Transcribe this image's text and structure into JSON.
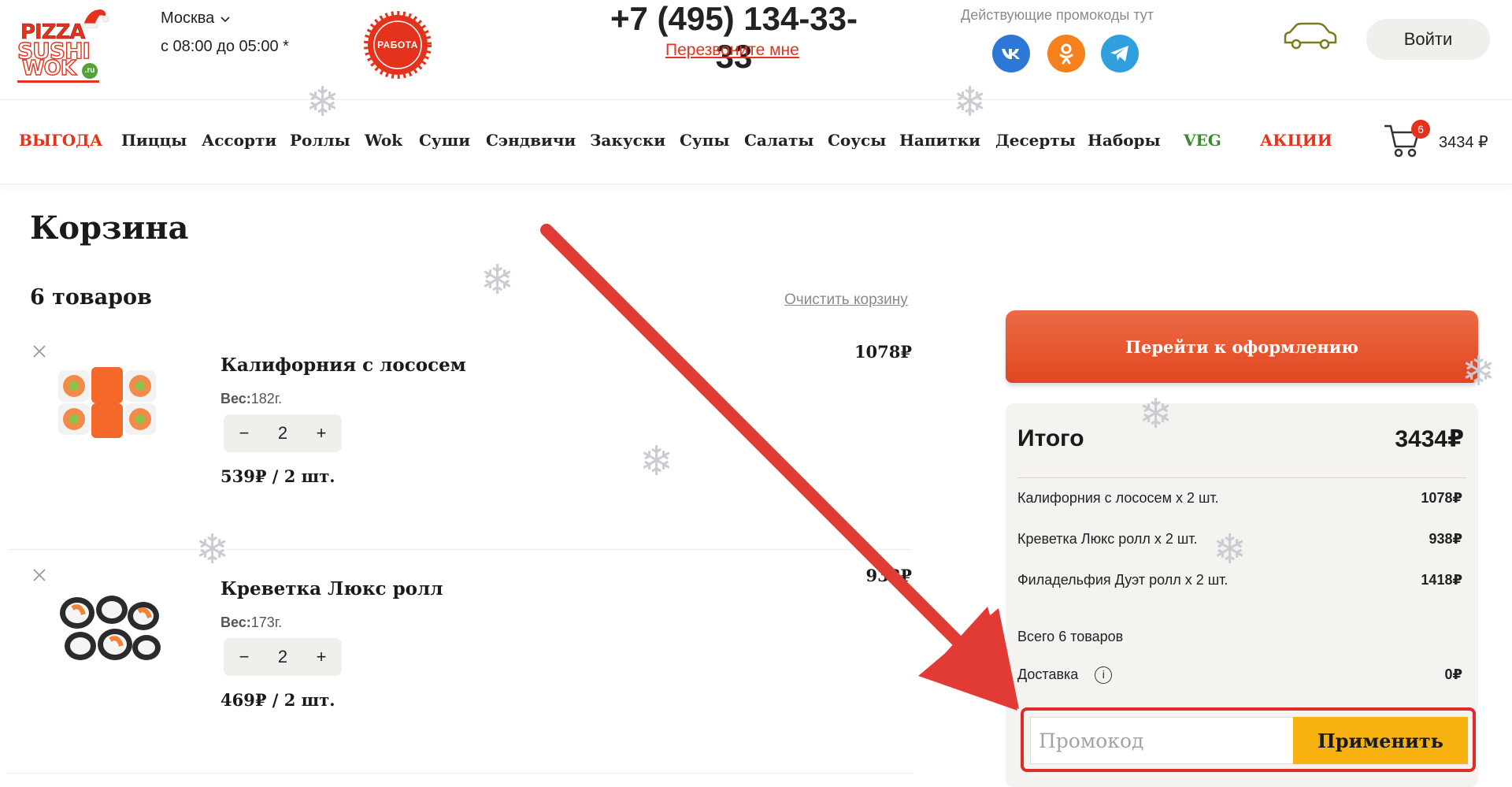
{
  "header": {
    "logo": {
      "line1": "PIZZA",
      "line2": "SUSHI",
      "line3": "WOK",
      "ru": ".ru"
    },
    "city": "Москва",
    "hours": "с 08:00 до 05:00 *",
    "work_badge": "РАБОТА",
    "phone": "+7 (495) 134-33-33",
    "callback": "Перезвоните мне",
    "promo_label": "Действующие промокоды тут",
    "social": {
      "vk": "vk",
      "ok": "ok",
      "tg": "tg"
    },
    "login": "Войти"
  },
  "nav": {
    "items": [
      "ВЫГОДА",
      "Пиццы",
      "Ассорти",
      "Роллы",
      "Wok",
      "Суши",
      "Сэндвичи",
      "Закуски",
      "Супы",
      "Салаты",
      "Соусы",
      "Напитки",
      "Десерты",
      "Наборы",
      "VEG",
      "АКЦИИ"
    ],
    "cart_count": "6",
    "cart_total": "3434 ₽"
  },
  "cart": {
    "title": "Корзина",
    "items_count": "6 товаров",
    "clear": "Очистить корзину",
    "items": [
      {
        "name": "Калифорния с лососем",
        "weight_label": "Вес:",
        "weight": "182г.",
        "qty": "2",
        "unit": "539₽ / 2 шт.",
        "price": "1078₽"
      },
      {
        "name": "Креветка Люкс ролл",
        "weight_label": "Вес:",
        "weight": "173г.",
        "qty": "2",
        "unit": "469₽ / 2 шт.",
        "price": "938₽"
      }
    ],
    "minus": "−",
    "plus": "+"
  },
  "summary": {
    "checkout": "Перейти к оформлению",
    "title": "Итого",
    "total": "3434₽",
    "lines": [
      {
        "label": "Калифорния с лососем х 2 шт.",
        "value": "1078₽"
      },
      {
        "label": "Креветка Люкс ролл х 2 шт.",
        "value": "938₽"
      },
      {
        "label": "Филадельфия Дуэт ролл х 2 шт.",
        "value": "1418₽"
      }
    ],
    "all_items": "Всего 6 товаров",
    "delivery_label": "Доставка",
    "delivery_value": "0₽",
    "promo_placeholder": "Промокод",
    "apply": "Применить"
  },
  "colors": {
    "brand_red": "#e4321c",
    "checkout_orange": "#e9572f",
    "apply_yellow": "#f7b212",
    "veg_green": "#3a8a2e"
  }
}
